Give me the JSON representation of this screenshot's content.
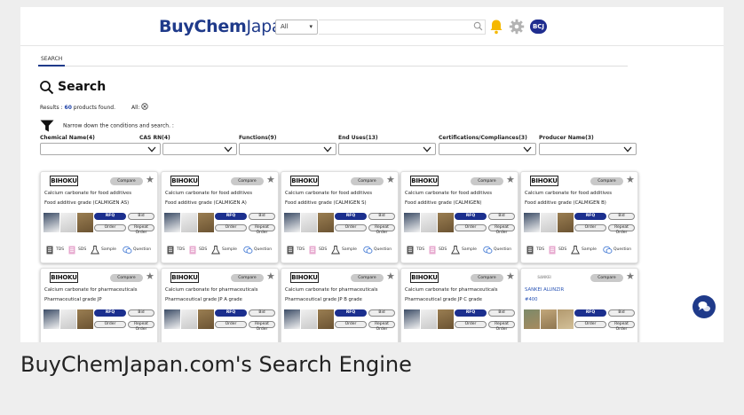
{
  "header": {
    "logo_bold": "BuyChem",
    "logo_rest": "Japan",
    "category_select": "All",
    "user_badge": "BCJ"
  },
  "tabs": [
    "SEARCH"
  ],
  "search": {
    "title": "Search",
    "results_prefix": "Results : ",
    "results_count": "60",
    "results_suffix": " products found.",
    "all_label": "All: ",
    "narrow_text": "Narrow down the conditions and search. :"
  },
  "filters": [
    {
      "label": "Chemical Name(4)"
    },
    {
      "label": "CAS RN(4)"
    },
    {
      "label": "Functions(9)"
    },
    {
      "label": "End Uses(13)"
    },
    {
      "label": "Certifications/Compliances(3)"
    },
    {
      "label": "Producer Name(3)"
    }
  ],
  "card_labels": {
    "compare": "Compare",
    "rfq": "RFQ",
    "bid": "Bid",
    "order": "Order",
    "repeat_order": "Repeat Order",
    "tds": "TDS",
    "sds": "SDS",
    "sample": "Sample",
    "question": "Question"
  },
  "products": [
    {
      "brand": "BIHOKU",
      "name": "Calcium carbonate for food additives",
      "grade": "Food additive grade (CALMIGEN AS)"
    },
    {
      "brand": "BIHOKU",
      "name": "Calcium carbonate for food additives",
      "grade": "Food additive grade (CALMIGEN A)"
    },
    {
      "brand": "BIHOKU",
      "name": "Calcium carbonate for food additives",
      "grade": "Food additive grade (CALMIGEN S)"
    },
    {
      "brand": "BIHOKU",
      "name": "Calcium carbonate for food additives",
      "grade": "Food additive grade (CALMIGEN)"
    },
    {
      "brand": "BIHOKU",
      "name": "Calcium carbonate for food additives",
      "grade": "Food additive grade (CALMIGEN B)"
    },
    {
      "brand": "BIHOKU",
      "name": "Calcium carbonate for pharmaceuticals",
      "grade": "Pharmaceutical grade JP"
    },
    {
      "brand": "BIHOKU",
      "name": "Calcium carbonate for pharmaceuticals",
      "grade": "Pharmaceutical grade JP A grade"
    },
    {
      "brand": "BIHOKU",
      "name": "Calcium carbonate for pharmaceuticals",
      "grade": "Pharmaceutical grade JP B grade"
    },
    {
      "brand": "BIHOKU",
      "name": "Calcium carbonate for pharmaceuticals",
      "grade": "Pharmaceutical grade JP C grade"
    },
    {
      "brand": "SANKEI",
      "name": "SANKEI ALUNZIR",
      "grade": "#400"
    }
  ],
  "caption": "BuyChemJapan.com's Search Engine"
}
